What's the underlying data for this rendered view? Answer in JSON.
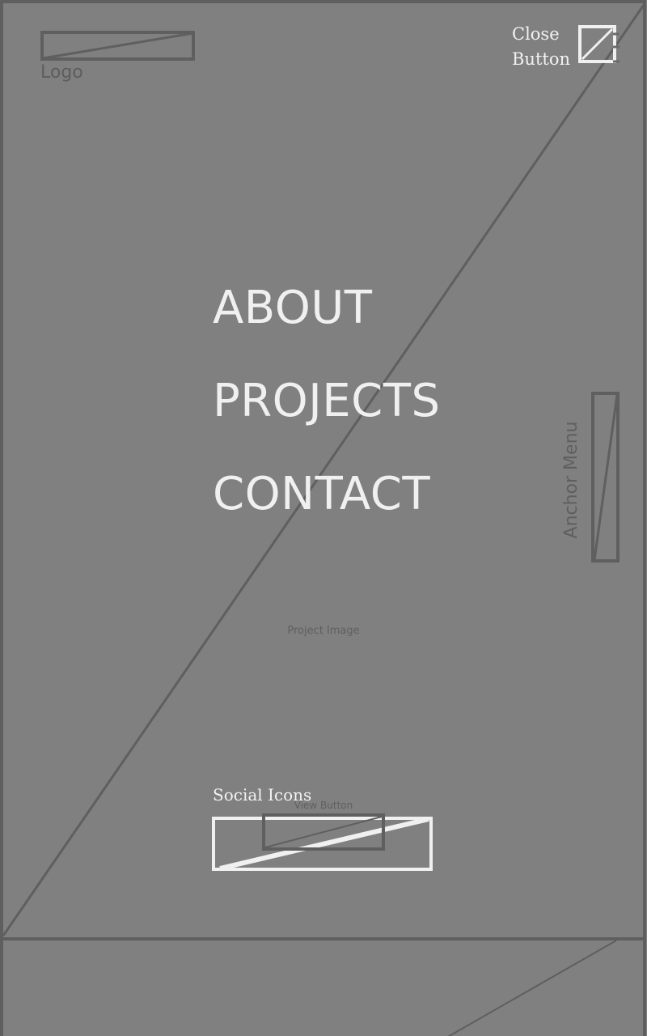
{
  "colors": {
    "background": "#808080",
    "wire_dark": "#5f5f5f",
    "wire_light": "#f0f0f0"
  },
  "header": {
    "logo_label": "Logo",
    "close_label": "Close Button"
  },
  "nav": {
    "items": [
      {
        "label": "ABOUT"
      },
      {
        "label": "PROJECTS"
      },
      {
        "label": "CONTACT"
      }
    ]
  },
  "side": {
    "anchor_label": "Anchor Menu"
  },
  "project": {
    "image_label": "Project Image",
    "view_button_label": "View Button"
  },
  "footer": {
    "social_label": "Social Icons"
  }
}
